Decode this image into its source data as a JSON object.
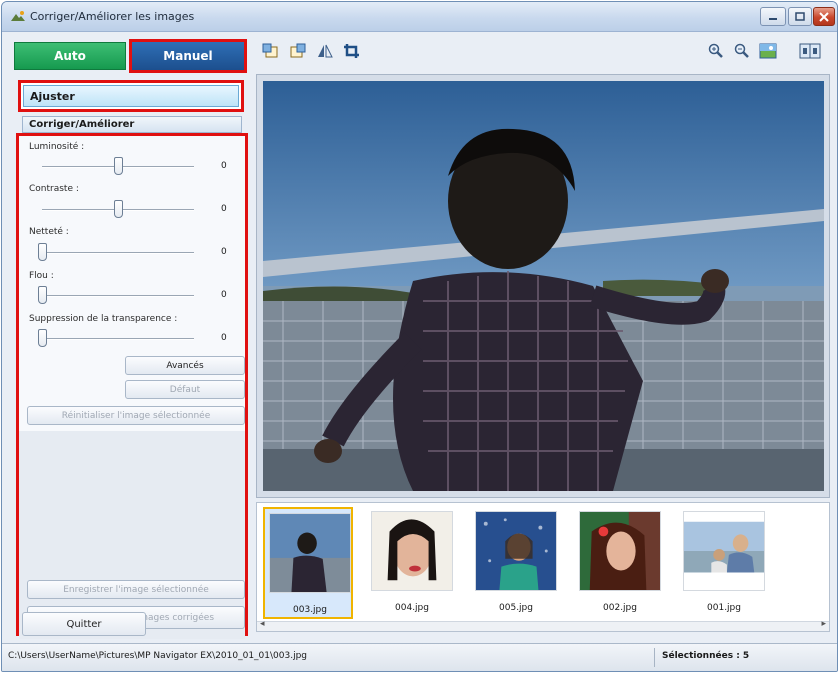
{
  "window": {
    "title": "Corriger/Améliorer les images"
  },
  "mode_tabs": {
    "auto": "Auto",
    "manual": "Manuel"
  },
  "side_nav": {
    "adjust": "Ajuster",
    "correct": "Corriger/Améliorer"
  },
  "sliders": [
    {
      "label": "Luminosité :",
      "value": "0",
      "position": 0.5
    },
    {
      "label": "Contraste :",
      "value": "0",
      "position": 0.5
    },
    {
      "label": "Netteté :",
      "value": "0",
      "position": 0.0
    },
    {
      "label": "Flou :",
      "value": "0",
      "position": 0.0
    },
    {
      "label": "Suppression de la transparence :",
      "value": "0",
      "position": 0.0
    }
  ],
  "buttons": {
    "advanced": "Avancés",
    "default": "Défaut",
    "reset_selected": "Réinitialiser l'image sélectionnée",
    "save_selected": "Enregistrer l'image sélectionnée",
    "save_all": "Enreg. toutes les images corrigées",
    "quit": "Quitter"
  },
  "toolbar": {
    "left_icons": [
      "rotate-left-icon",
      "rotate-right-icon",
      "flip-icon",
      "crop-icon"
    ],
    "right_icons": [
      "zoom-in-icon",
      "zoom-out-icon",
      "full-image-icon",
      "compare-icon"
    ]
  },
  "thumbnails": [
    {
      "name": "003.jpg",
      "selected": true
    },
    {
      "name": "004.jpg",
      "selected": false
    },
    {
      "name": "005.jpg",
      "selected": false
    },
    {
      "name": "002.jpg",
      "selected": false
    },
    {
      "name": "001.jpg",
      "selected": false
    }
  ],
  "status": {
    "path": "C:\\Users\\UserName\\Pictures\\MP Navigator EX\\2010_01_01\\003.jpg",
    "selected": "Sélectionnées : 5"
  },
  "colors": {
    "highlight_frame": "#e01010",
    "auto_tab": "#169a4f",
    "manual_tab": "#1c4f8e",
    "selection_border": "#f0b400"
  }
}
